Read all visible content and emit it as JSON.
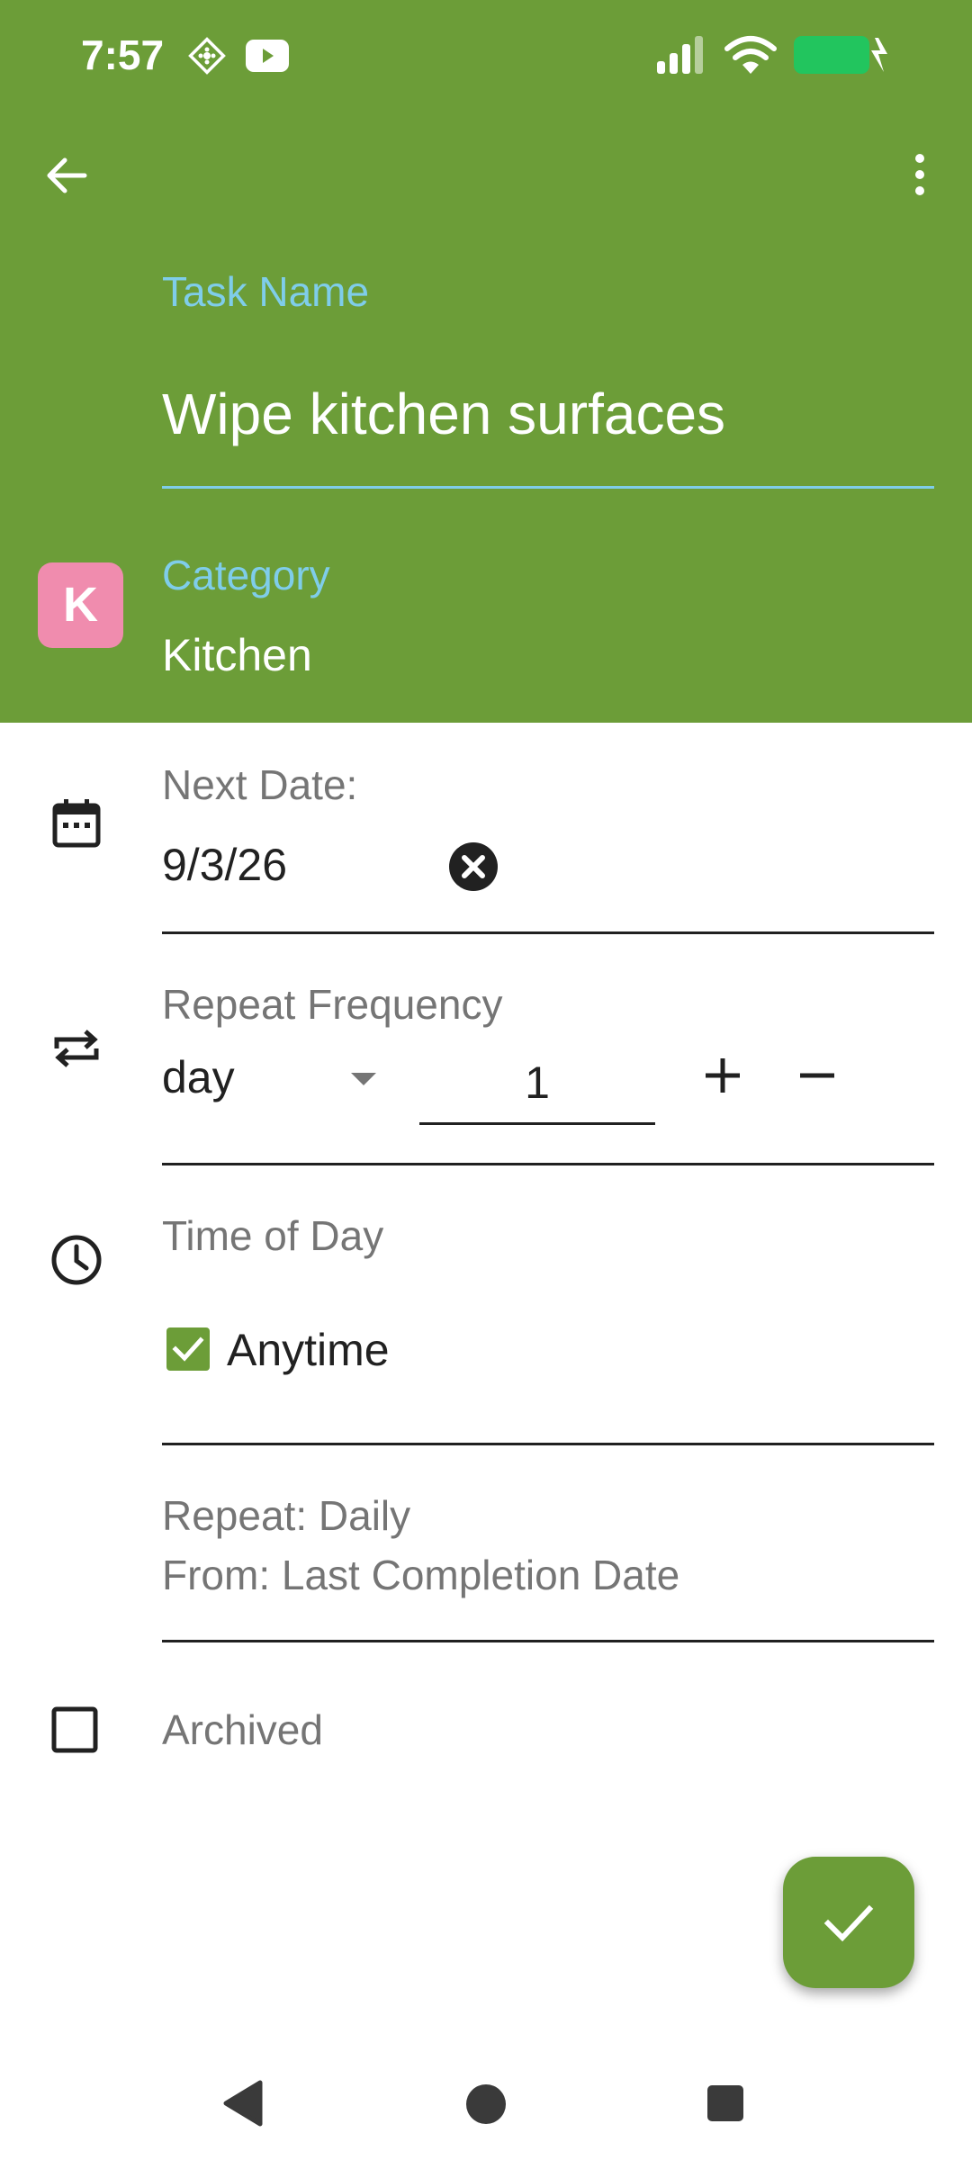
{
  "status_bar": {
    "time": "7:57",
    "icons": [
      "settings-diamond-icon",
      "youtube-icon",
      "signal-icon",
      "wifi-icon",
      "battery-charging-icon"
    ],
    "battery_color": "#22c55e"
  },
  "header": {
    "background": "#6c9d38",
    "back_icon": "arrow-left-icon",
    "menu_icon": "more-vert-icon"
  },
  "task": {
    "label": "Task Name",
    "value": "Wipe kitchen surfaces"
  },
  "category": {
    "avatar_letter": "K",
    "avatar_color": "#f08cae",
    "label": "Category",
    "value": "Kitchen"
  },
  "next_date": {
    "icon": "calendar-icon",
    "label": "Next Date:",
    "value": "9/3/26",
    "clear_icon": "clear-circle-icon"
  },
  "repeat_frequency": {
    "icon": "repeat-icon",
    "label": "Repeat Frequency",
    "unit": "day",
    "count": "1",
    "increment_icon": "plus-icon",
    "decrement_icon": "minus-icon"
  },
  "time_of_day": {
    "icon": "clock-icon",
    "label": "Time of Day",
    "anytime_label": "Anytime",
    "anytime_checked": true
  },
  "summary": {
    "repeat_line": "Repeat: Daily",
    "from_line": "From: Last Completion Date"
  },
  "archived": {
    "label": "Archived",
    "checked": false
  },
  "fab": {
    "icon": "check-icon"
  },
  "nav_bar": {
    "icons": [
      "nav-back-icon",
      "nav-home-icon",
      "nav-recents-icon"
    ]
  }
}
